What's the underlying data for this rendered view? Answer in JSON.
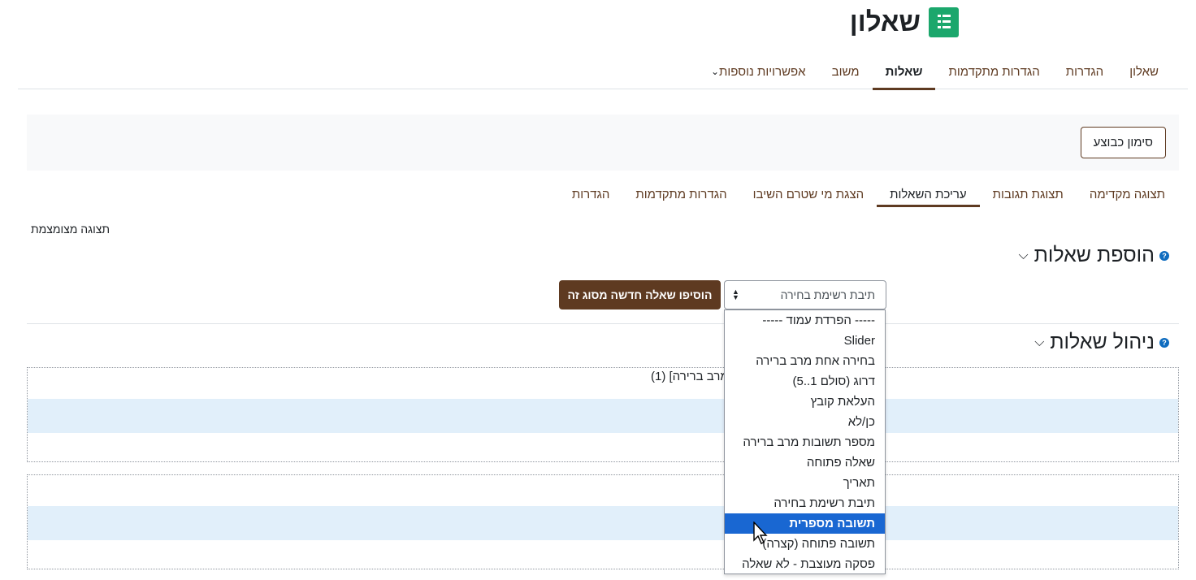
{
  "header": {
    "title": "שאלון",
    "icon": "questionnaire-list-icon",
    "icon_color": "#1ba76c"
  },
  "primary_nav": {
    "items": [
      "שאלון",
      "הגדרות",
      "הגדרות מתקדמות",
      "שאלות",
      "משוב",
      "אפשרויות נוספות"
    ],
    "active": "שאלות"
  },
  "completion": {
    "mark_done_label": "סימון כבוצע"
  },
  "secondary_nav": {
    "items": [
      "תצוגה מקדימה",
      "תצוגת תגובות",
      "עריכת השאלות",
      "הצגת מי שטרם השיבו",
      "הגדרות מתקדמות",
      "הגדרות"
    ],
    "active": "עריכת השאלות"
  },
  "compact_view_label": "תצוגה מצומצמת",
  "add_questions": {
    "heading": "הוספת שאלות",
    "select_value": "תיבת רשימת בחירה",
    "add_button_label": "הוסיפו שאלה חדשה מסוג זה"
  },
  "manage_questions": {
    "heading": "ניהול שאלות",
    "question1_title": "מרב ברירה] (1)"
  },
  "dropdown": {
    "options": [
      "----- הפרדת עמוד -----",
      "Slider",
      "בחירה אחת מרב ברירה",
      "דרוג (סולם 1..5)",
      "העלאת קובץ",
      "כן/לא",
      "מספר תשובות מרב ברירה",
      "שאלה פתוחה",
      "תאריך",
      "תיבת רשימת בחירה",
      "תשובה מספרית",
      "תשובה פתוחה (קצרה)",
      "פסקה מעוצבת - לא שאלה"
    ],
    "highlighted": "תשובה מספרית"
  },
  "colors": {
    "brand": "#5e3a21",
    "highlight": "#1967d2",
    "row_shade": "#e1effa",
    "help": "#0f6cbf"
  }
}
